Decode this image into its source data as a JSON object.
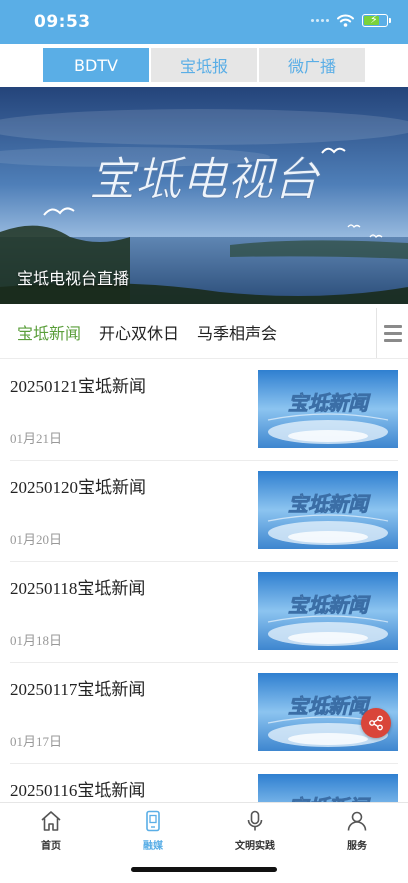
{
  "status_bar": {
    "time": "09:53",
    "battery_level": 0.7
  },
  "top_tabs": {
    "active_index": 0,
    "items": [
      {
        "label": "BDTV"
      },
      {
        "label": "宝坻报"
      },
      {
        "label": "微广播"
      }
    ]
  },
  "banner": {
    "title_art": "宝坻电视台",
    "caption": "宝坻电视台直播"
  },
  "categories": {
    "active_index": 0,
    "items": [
      {
        "label": "宝坻新闻"
      },
      {
        "label": "开心双休日"
      },
      {
        "label": "马季相声会"
      }
    ]
  },
  "news": [
    {
      "title": "20250121宝坻新闻",
      "date": "01月21日",
      "thumb_text": "宝坻新闻"
    },
    {
      "title": "20250120宝坻新闻",
      "date": "01月20日",
      "thumb_text": "宝坻新闻"
    },
    {
      "title": "20250118宝坻新闻",
      "date": "01月18日",
      "thumb_text": "宝坻新闻"
    },
    {
      "title": "20250117宝坻新闻",
      "date": "01月17日",
      "thumb_text": "宝坻新闻"
    },
    {
      "title": "20250116宝坻新闻",
      "date": "",
      "thumb_text": "宝坻新闻"
    }
  ],
  "bottom_nav": {
    "active_index": 1,
    "items": [
      {
        "label": "首页",
        "icon": "home-icon"
      },
      {
        "label": "融媒",
        "icon": "media-device-icon"
      },
      {
        "label": "文明实践",
        "icon": "microphone-icon"
      },
      {
        "label": "服务",
        "icon": "person-icon"
      }
    ]
  },
  "colors": {
    "primary": "#5aaee6",
    "active_category": "#5a9e3a",
    "share": "#d9453a"
  }
}
